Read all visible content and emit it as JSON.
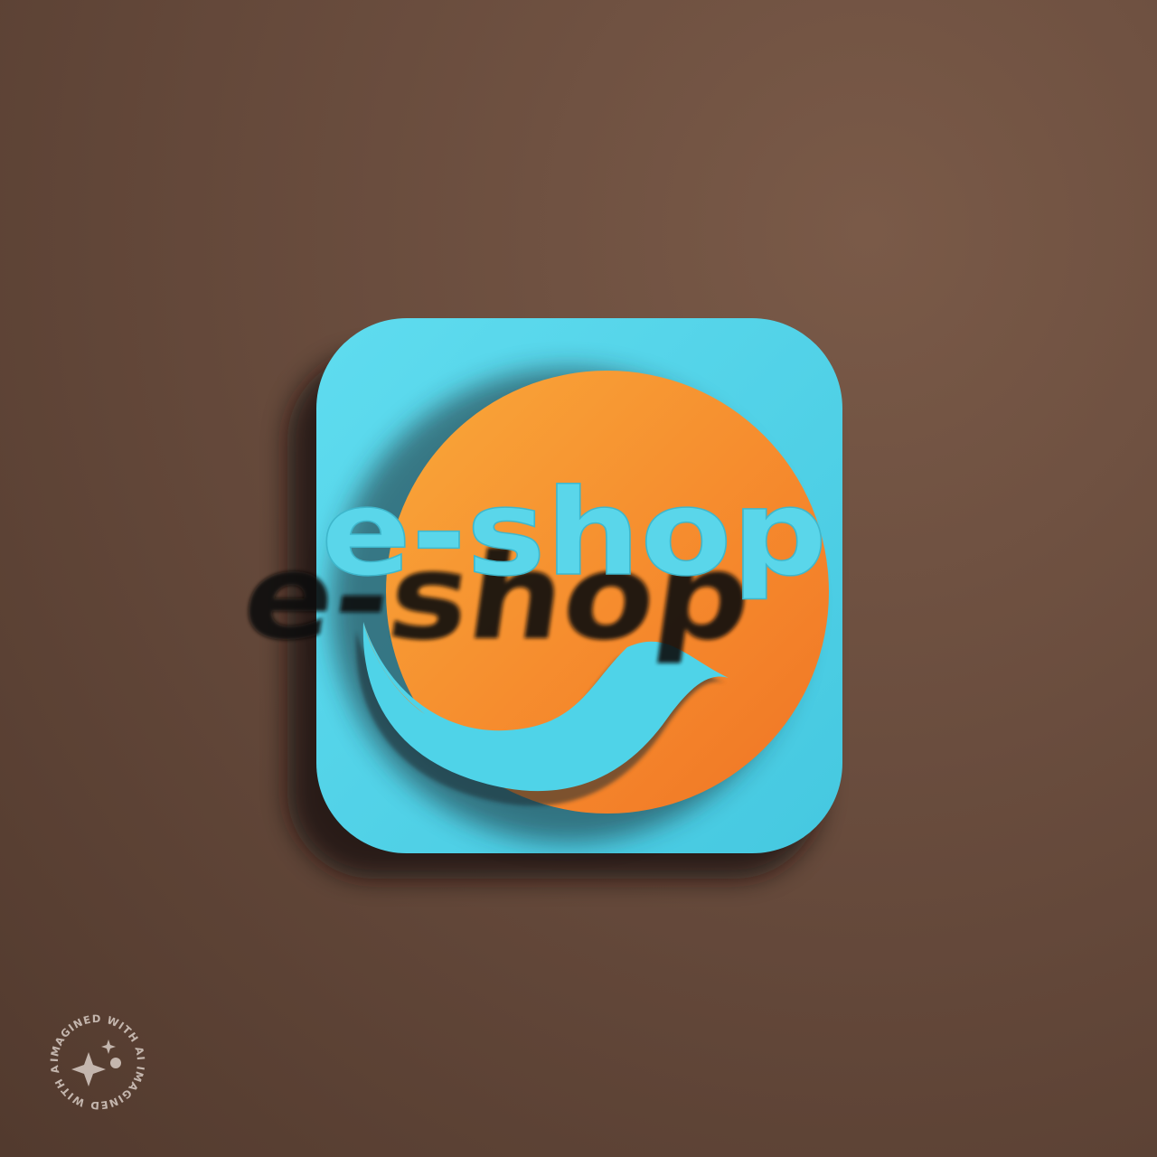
{
  "logo": {
    "wordmark": "e-shop"
  },
  "watermark": {
    "text": "IMAGINED WITH AI IMAGINED WITH AI",
    "icon": "sparkle-icon"
  },
  "colors": {
    "background": "#6a4d3e",
    "tile": "#4fd3e8",
    "circle": "#f5872a",
    "circle_light": "#f9a035",
    "wordmark_fill": "#5ad6ea",
    "shadow": "#1a1210"
  }
}
